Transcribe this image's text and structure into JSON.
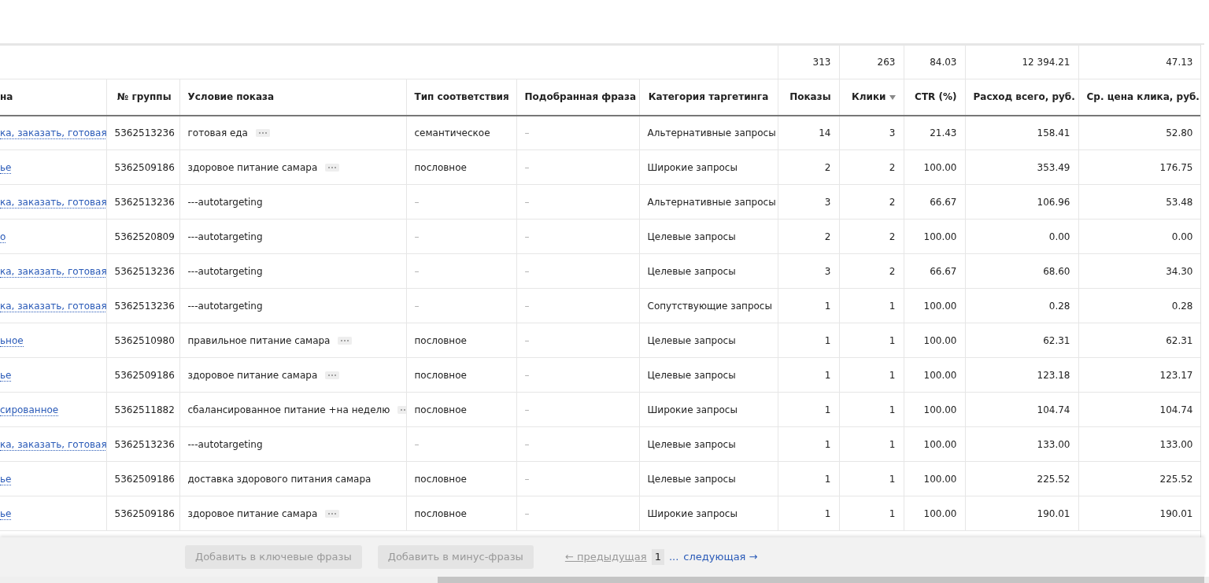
{
  "totals": [
    "313",
    "263",
    "84.03",
    "12 394.21",
    "47.13"
  ],
  "columns": [
    {
      "label": "на",
      "sorted": false
    },
    {
      "label": "№ группы",
      "sorted": false
    },
    {
      "label": "Условие показа",
      "sorted": false
    },
    {
      "label": "Тип соответствия",
      "sorted": false
    },
    {
      "label": "Подобранная фраза",
      "sorted": false
    },
    {
      "label": "Категория таргетинга",
      "sorted": false
    },
    {
      "label": "Показы",
      "sorted": false
    },
    {
      "label": "Клики",
      "sorted": true
    },
    {
      "label": "CTR (%)",
      "sorted": false
    },
    {
      "label": "Расход всего, руб.",
      "sorted": false
    },
    {
      "label": "Ср. цена клика, руб.",
      "sorted": false
    }
  ],
  "rows": [
    {
      "link": "ка, заказать, готовая",
      "group": "5362513236",
      "condition": "готовая еда",
      "has_more": true,
      "match": "семантическое",
      "phrase": "–",
      "category": "Альтернативные запросы",
      "shows": "14",
      "clicks": "3",
      "ctr": "21.43",
      "spend": "158.41",
      "cpc": "52.80"
    },
    {
      "link": "ье",
      "group": "5362509186",
      "condition": "здоровое питание самара",
      "has_more": true,
      "match": "пословное",
      "phrase": "–",
      "category": "Широкие запросы",
      "shows": "2",
      "clicks": "2",
      "ctr": "100.00",
      "spend": "353.49",
      "cpc": "176.75"
    },
    {
      "link": "ка, заказать, готовая",
      "group": "5362513236",
      "condition": "---autotargeting",
      "has_more": false,
      "match": "–",
      "phrase": "–",
      "category": "Альтернативные запросы",
      "shows": "3",
      "clicks": "2",
      "ctr": "66.67",
      "spend": "106.96",
      "cpc": "53.48"
    },
    {
      "link": "о",
      "group": "5362520809",
      "condition": "---autotargeting",
      "has_more": false,
      "match": "–",
      "phrase": "–",
      "category": "Целевые запросы",
      "shows": "2",
      "clicks": "2",
      "ctr": "100.00",
      "spend": "0.00",
      "cpc": "0.00"
    },
    {
      "link": "ка, заказать, готовая",
      "group": "5362513236",
      "condition": "---autotargeting",
      "has_more": false,
      "match": "–",
      "phrase": "–",
      "category": "Целевые запросы",
      "shows": "3",
      "clicks": "2",
      "ctr": "66.67",
      "spend": "68.60",
      "cpc": "34.30"
    },
    {
      "link": "ка, заказать, готовая",
      "group": "5362513236",
      "condition": "---autotargeting",
      "has_more": false,
      "match": "–",
      "phrase": "–",
      "category": "Сопутствующие запросы",
      "shows": "1",
      "clicks": "1",
      "ctr": "100.00",
      "spend": "0.28",
      "cpc": "0.28"
    },
    {
      "link": "ьное",
      "group": "5362510980",
      "condition": "правильное питание самара",
      "has_more": true,
      "match": "пословное",
      "phrase": "–",
      "category": "Целевые запросы",
      "shows": "1",
      "clicks": "1",
      "ctr": "100.00",
      "spend": "62.31",
      "cpc": "62.31"
    },
    {
      "link": "ье",
      "group": "5362509186",
      "condition": "здоровое питание самара",
      "has_more": true,
      "match": "пословное",
      "phrase": "–",
      "category": "Целевые запросы",
      "shows": "1",
      "clicks": "1",
      "ctr": "100.00",
      "spend": "123.18",
      "cpc": "123.17"
    },
    {
      "link": "сированное",
      "group": "5362511882",
      "condition": "сбалансированное питание +на неделю",
      "has_more": true,
      "match": "пословное",
      "phrase": "–",
      "category": "Широкие запросы",
      "shows": "1",
      "clicks": "1",
      "ctr": "100.00",
      "spend": "104.74",
      "cpc": "104.74"
    },
    {
      "link": "ка, заказать, готовая",
      "group": "5362513236",
      "condition": "---autotargeting",
      "has_more": false,
      "match": "–",
      "phrase": "–",
      "category": "Целевые запросы",
      "shows": "1",
      "clicks": "1",
      "ctr": "100.00",
      "spend": "133.00",
      "cpc": "133.00"
    },
    {
      "link": "ье",
      "group": "5362509186",
      "condition": "доставка здорового питания самара",
      "has_more": false,
      "match": "пословное",
      "phrase": "–",
      "category": "Целевые запросы",
      "shows": "1",
      "clicks": "1",
      "ctr": "100.00",
      "spend": "225.52",
      "cpc": "225.52"
    },
    {
      "link": "ье",
      "group": "5362509186",
      "condition": "здоровое питание самара",
      "has_more": true,
      "match": "пословное",
      "phrase": "–",
      "category": "Широкие запросы",
      "shows": "1",
      "clicks": "1",
      "ctr": "100.00",
      "spend": "190.01",
      "cpc": "190.01"
    }
  ],
  "footer": {
    "buttons": [
      {
        "label": "Добавить в ключевые фразы",
        "disabled": true
      },
      {
        "label": "Добавить в минус-фразы",
        "disabled": true
      }
    ],
    "pagination": {
      "prev": {
        "label": "← предыдущая",
        "disabled": true
      },
      "pages": [
        {
          "label": "1",
          "selected": true
        }
      ],
      "ellipsis": "...",
      "next": {
        "label": "следующая →",
        "disabled": false
      }
    }
  }
}
